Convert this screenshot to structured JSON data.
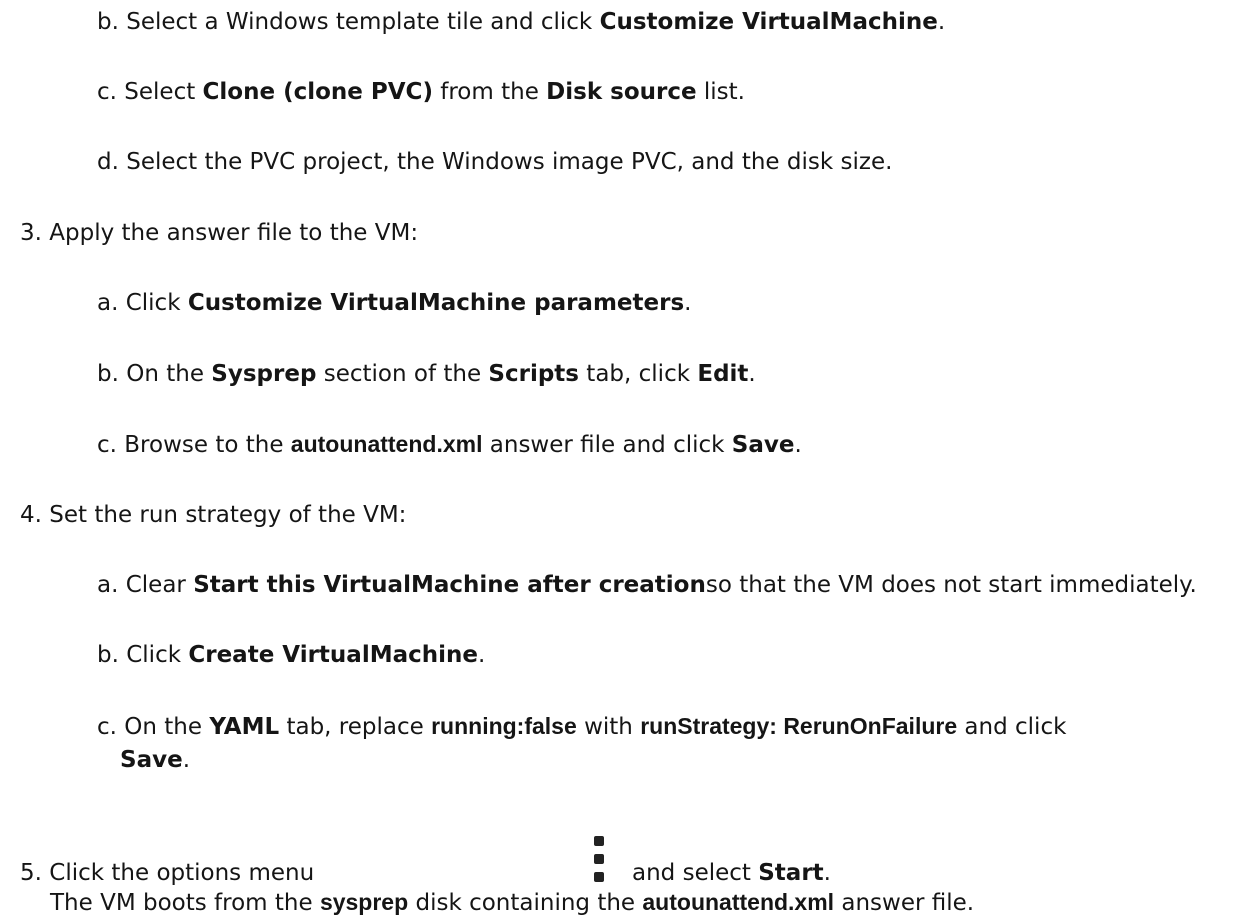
{
  "steps": [
    {
      "marker": "b.",
      "parts": [
        "Select a Windows template tile and click ",
        "Customize VirtualMachine",
        "."
      ]
    },
    {
      "marker": "c.",
      "parts": [
        "Select ",
        "Clone (clone PVC)",
        " from the ",
        "Disk source",
        " list."
      ]
    },
    {
      "marker": "d.",
      "text": "Select the PVC project, the Windows image PVC, and the disk size."
    },
    {
      "marker": "3.",
      "text": "Apply the answer file to the VM:"
    },
    {
      "marker": "a.",
      "parts": [
        "Click ",
        "Customize VirtualMachine parameters",
        "."
      ]
    },
    {
      "marker": "b.",
      "parts": [
        "On the ",
        "Sysprep",
        " section of the ",
        "Scripts",
        " tab, click ",
        "Edit",
        "."
      ]
    },
    {
      "marker": "c.",
      "parts": [
        "Browse to the ",
        "autounattend.xml",
        " answer file and click ",
        "Save",
        "."
      ]
    },
    {
      "marker": "4.",
      "text": "Set the run strategy of the VM:"
    },
    {
      "marker": "a.",
      "parts": [
        "Clear ",
        "Start this VirtualMachine after creation",
        "so that the VM does not start immediately."
      ]
    },
    {
      "marker": "b.",
      "parts": [
        "Click ",
        "Create VirtualMachine",
        "."
      ]
    },
    {
      "marker": "c.",
      "parts": [
        "On the ",
        "YAML",
        " tab, replace ",
        "running:false",
        " with ",
        "runStrategy: RerunOnFailure",
        " and click"
      ],
      "continuation": [
        "Save",
        "."
      ]
    },
    {
      "marker": "5.",
      "parts": [
        "Click the options menu",
        "and select ",
        "Start",
        "."
      ],
      "icon": "kebab-menu-icon",
      "result": [
        "The VM boots from the ",
        "sysprep",
        " disk containing the ",
        "autounattend.xml",
        " answer file."
      ]
    }
  ]
}
